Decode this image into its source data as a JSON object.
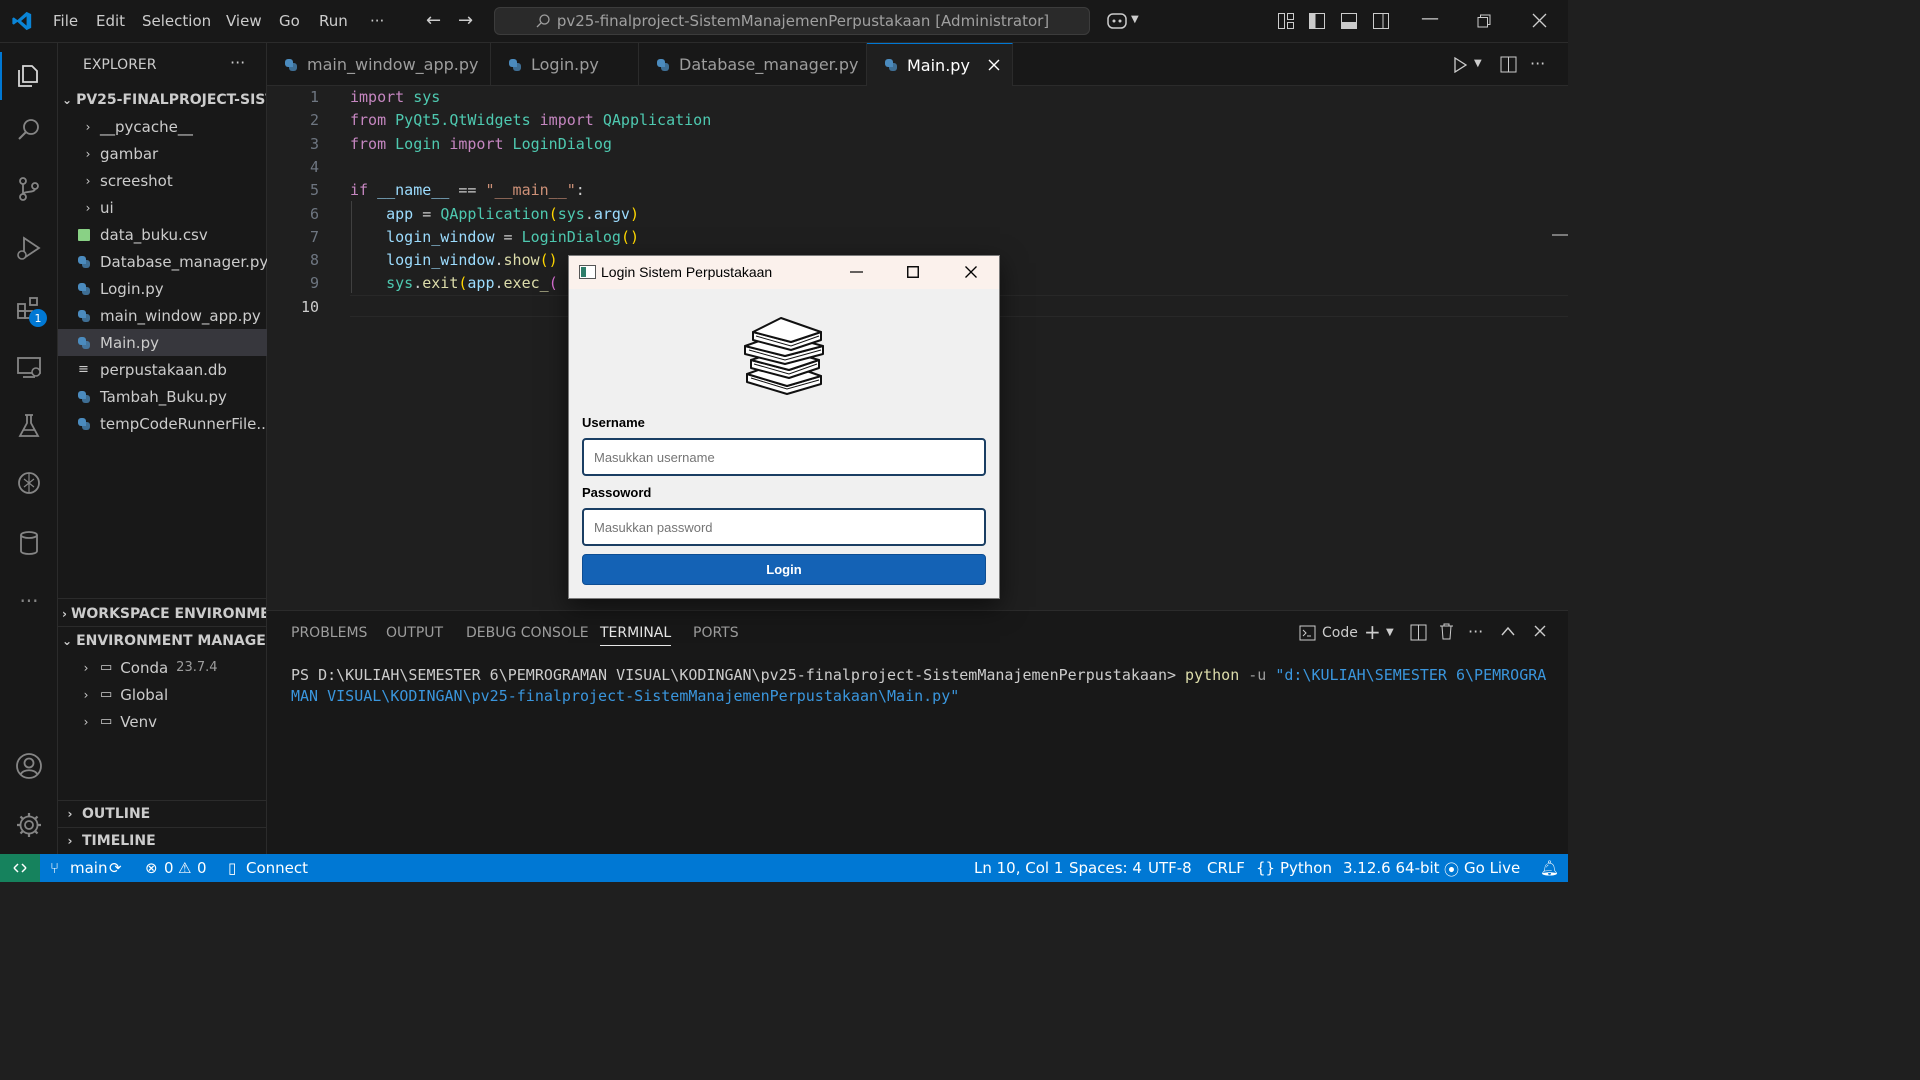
{
  "titlebar": {
    "menu": [
      "File",
      "Edit",
      "Selection",
      "View",
      "Go",
      "Run",
      "···"
    ],
    "search_text": "pv25-finalproject-SistemManajemenPerpustakaan [Administrator]"
  },
  "activitybar": {
    "extensions_badge": "1"
  },
  "explorer": {
    "header": "EXPLORER",
    "more": "···",
    "root": "PV25-FINALPROJECT-SIST...",
    "items": [
      {
        "label": "__pycache__",
        "type": "folder"
      },
      {
        "label": "gambar",
        "type": "folder"
      },
      {
        "label": "screeshot",
        "type": "folder"
      },
      {
        "label": "ui",
        "type": "folder"
      },
      {
        "label": "data_buku.csv",
        "type": "csv"
      },
      {
        "label": "Database_manager.py",
        "type": "py"
      },
      {
        "label": "Login.py",
        "type": "py"
      },
      {
        "label": "main_window_app.py",
        "type": "py"
      },
      {
        "label": "Main.py",
        "type": "py",
        "selected": true
      },
      {
        "label": "perpustakaan.db",
        "type": "db"
      },
      {
        "label": "Tambah_Buku.py",
        "type": "py"
      },
      {
        "label": "tempCodeRunnerFile....",
        "type": "py"
      }
    ],
    "workspace_env": "WORKSPACE ENVIRONME...",
    "env_manager": "ENVIRONMENT MANAGER...",
    "envs": [
      {
        "name": "Conda",
        "version": "23.7.4"
      },
      {
        "name": "Global",
        "version": ""
      },
      {
        "name": "Venv",
        "version": ""
      }
    ],
    "outline": "OUTLINE",
    "timeline": "TIMELINE"
  },
  "tabs": [
    {
      "label": "main_window_app.py",
      "active": false
    },
    {
      "label": "Login.py",
      "active": false
    },
    {
      "label": "Database_manager.py",
      "active": false
    },
    {
      "label": "Main.py",
      "active": true
    }
  ],
  "editor": {
    "line_numbers": [
      "1",
      "2",
      "3",
      "4",
      "5",
      "6",
      "7",
      "8",
      "9",
      "10"
    ],
    "current_line": "10",
    "lines": [
      [
        {
          "t": "import",
          "c": "kw"
        },
        {
          "t": " sys",
          "c": "cls"
        }
      ],
      [
        {
          "t": "from",
          "c": "kw"
        },
        {
          "t": " PyQt5.QtWidgets ",
          "c": "cls"
        },
        {
          "t": "import",
          "c": "kw"
        },
        {
          "t": " QApplication",
          "c": "cls"
        }
      ],
      [
        {
          "t": "from",
          "c": "kw"
        },
        {
          "t": " Login ",
          "c": "cls"
        },
        {
          "t": "import",
          "c": "kw"
        },
        {
          "t": " LoginDialog",
          "c": "cls"
        }
      ],
      [],
      [
        {
          "t": "if",
          "c": "kw"
        },
        {
          "t": " ",
          "c": ""
        },
        {
          "t": "__name__",
          "c": "var"
        },
        {
          "t": " == ",
          "c": ""
        },
        {
          "t": "\"__main__\"",
          "c": "str"
        },
        {
          "t": ":",
          "c": ""
        }
      ],
      [
        {
          "t": "    ",
          "c": ""
        },
        {
          "t": "app",
          "c": "var"
        },
        {
          "t": " = ",
          "c": ""
        },
        {
          "t": "QApplication",
          "c": "cls"
        },
        {
          "t": "(",
          "c": "br"
        },
        {
          "t": "sys",
          "c": "cls"
        },
        {
          "t": ".",
          "c": ""
        },
        {
          "t": "argv",
          "c": "var"
        },
        {
          "t": ")",
          "c": "br"
        }
      ],
      [
        {
          "t": "    ",
          "c": ""
        },
        {
          "t": "login_window",
          "c": "var"
        },
        {
          "t": " = ",
          "c": ""
        },
        {
          "t": "LoginDialog",
          "c": "cls"
        },
        {
          "t": "()",
          "c": "br"
        }
      ],
      [
        {
          "t": "    ",
          "c": ""
        },
        {
          "t": "login_window",
          "c": "var"
        },
        {
          "t": ".",
          "c": ""
        },
        {
          "t": "show",
          "c": "fn"
        },
        {
          "t": "()",
          "c": "br"
        }
      ],
      [
        {
          "t": "    ",
          "c": ""
        },
        {
          "t": "sys",
          "c": "cls"
        },
        {
          "t": ".",
          "c": ""
        },
        {
          "t": "exit",
          "c": "fn"
        },
        {
          "t": "(",
          "c": "br"
        },
        {
          "t": "app",
          "c": "var"
        },
        {
          "t": ".",
          "c": ""
        },
        {
          "t": "exec_",
          "c": "fn"
        },
        {
          "t": "(",
          "c": "br2"
        }
      ],
      []
    ]
  },
  "panel": {
    "tabs": [
      "PROBLEMS",
      "OUTPUT",
      "DEBUG CONSOLE",
      "TERMINAL",
      "PORTS"
    ],
    "active_tab": "TERMINAL",
    "terminal_label": "Code",
    "prompt": "PS D:\\KULIAH\\SEMESTER 6\\PEMROGRAMAN VISUAL\\KODINGAN\\pv25-finalproject-SistemManajemenPerpustakaan> ",
    "cmd": "python",
    "flag": " -u ",
    "path": "\"d:\\KULIAH\\SEMESTER 6\\PEMROGRAMAN VISUAL\\KODINGAN\\pv25-finalproject-SistemManajemenPerpustakaan\\Main.py\""
  },
  "dialog": {
    "title": "Login Sistem Perpustakaan",
    "username_label": "Username",
    "username_placeholder": "Masukkan username",
    "password_label": "Passoword",
    "password_placeholder": "Masukkan password",
    "login_button": "Login"
  },
  "statusbar": {
    "branch": "main",
    "errors": "0",
    "warnings": "0",
    "connect": "Connect",
    "position": "Ln 10, Col 1",
    "spaces": "Spaces: 4",
    "encoding": "UTF-8",
    "eol": "CRLF",
    "language": "Python",
    "interpreter": "3.12.6 64-bit",
    "golive": "Go Live"
  },
  "colors": {
    "accent": "#0078d4",
    "statusbar": "#0078d4",
    "login_button": "#1462b5",
    "python_icon": "#4b8bbe"
  }
}
